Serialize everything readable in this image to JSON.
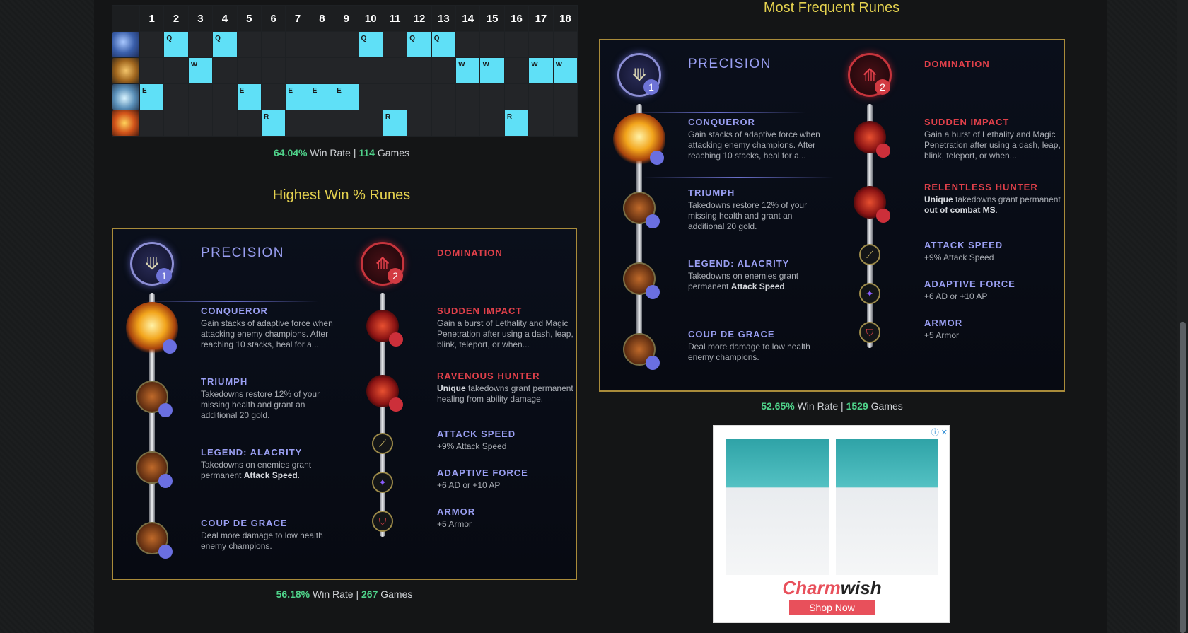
{
  "skill_order": {
    "levels": [
      "1",
      "2",
      "3",
      "4",
      "5",
      "6",
      "7",
      "8",
      "9",
      "10",
      "11",
      "12",
      "13",
      "14",
      "15",
      "16",
      "17",
      "18"
    ],
    "rows": [
      {
        "ability": "q-ability-icon",
        "keys": [
          "",
          "Q",
          "",
          "Q",
          "",
          "",
          "",
          "",
          "",
          "Q",
          "",
          "Q",
          "Q",
          "",
          "",
          "",
          "",
          ""
        ]
      },
      {
        "ability": "w-ability-icon",
        "keys": [
          "",
          "",
          "W",
          "",
          "",
          "",
          "",
          "",
          "",
          "",
          "",
          "",
          "",
          "W",
          "W",
          "",
          "W",
          "W"
        ]
      },
      {
        "ability": "e-ability-icon",
        "keys": [
          "E",
          "",
          "",
          "",
          "E",
          "",
          "E",
          "E",
          "E",
          "",
          "",
          "",
          "",
          "",
          "",
          "",
          "",
          ""
        ]
      },
      {
        "ability": "r-ability-icon",
        "keys": [
          "",
          "",
          "",
          "",
          "",
          "R",
          "",
          "",
          "",
          "",
          "R",
          "",
          "",
          "",
          "",
          "R",
          "",
          ""
        ]
      }
    ],
    "win_rate": "64.04%",
    "win_rate_label": "Win Rate |",
    "games": "114",
    "games_label": "Games"
  },
  "highest_win": {
    "title": "Highest Win % Runes",
    "primary_tree": "PRECISION",
    "primary_num": "1",
    "secondary_tree": "DOMINATION",
    "secondary_num": "2",
    "primary_runes": [
      {
        "name": "CONQUEROR",
        "desc": "Gain stacks of adaptive force when attacking enemy champions. After reaching 10 stacks, heal for a..."
      },
      {
        "name": "TRIUMPH",
        "desc": "Takedowns restore 12% of your missing health and grant an additional 20 gold."
      },
      {
        "name": "LEGEND: ALACRITY",
        "desc_pre": "Takedowns on enemies grant permanent ",
        "desc_bold": "Attack Speed",
        "desc_post": "."
      },
      {
        "name": "COUP DE GRACE",
        "desc": "Deal more damage to low health enemy champions."
      }
    ],
    "secondary_runes": [
      {
        "name": "SUDDEN IMPACT",
        "desc": "Gain a burst of Lethality and Magic Penetration after using a dash, leap, blink, teleport, or when..."
      },
      {
        "name": "RAVENOUS HUNTER",
        "desc_bold": "Unique",
        "desc_post": " takedowns grant permanent healing from ability damage."
      }
    ],
    "shards": [
      {
        "name": "ATTACK SPEED",
        "desc": "+9% Attack Speed"
      },
      {
        "name": "ADAPTIVE FORCE",
        "desc": "+6 AD or +10 AP"
      },
      {
        "name": "ARMOR",
        "desc": "+5 Armor"
      }
    ],
    "win_rate": "56.18%",
    "win_rate_label": "Win Rate |",
    "games": "267",
    "games_label": "Games"
  },
  "most_frequent": {
    "title": "Most Frequent Runes",
    "primary_tree": "PRECISION",
    "primary_num": "1",
    "secondary_tree": "DOMINATION",
    "secondary_num": "2",
    "primary_runes": [
      {
        "name": "CONQUEROR",
        "desc": "Gain stacks of adaptive force when attacking enemy champions. After reaching 10 stacks, heal for a..."
      },
      {
        "name": "TRIUMPH",
        "desc": "Takedowns restore 12% of your missing health and grant an additional 20 gold."
      },
      {
        "name": "LEGEND: ALACRITY",
        "desc_pre": "Takedowns on enemies grant permanent ",
        "desc_bold": "Attack Speed",
        "desc_post": "."
      },
      {
        "name": "COUP DE GRACE",
        "desc": "Deal more damage to low health enemy champions."
      }
    ],
    "secondary_runes": [
      {
        "name": "SUDDEN IMPACT",
        "desc": "Gain a burst of Lethality and Magic Penetration after using a dash, leap, blink, teleport, or when..."
      },
      {
        "name": "RELENTLESS HUNTER",
        "desc_bold": "Unique",
        "desc_post": " takedowns grant permanent ",
        "desc_bold2": "out of combat MS",
        "desc_post2": "."
      }
    ],
    "shards": [
      {
        "name": "ATTACK SPEED",
        "desc": "+9% Attack Speed"
      },
      {
        "name": "ADAPTIVE FORCE",
        "desc": "+6 AD or +10 AP"
      },
      {
        "name": "ARMOR",
        "desc": "+5 Armor"
      }
    ],
    "win_rate": "52.65%",
    "win_rate_label": "Win Rate |",
    "games": "1529",
    "games_label": "Games"
  },
  "ad": {
    "brand_part1": "Charm",
    "brand_part2": "wish",
    "button": "Shop Now",
    "close": "ⓘ ✕"
  },
  "colors": {
    "highlight": "#5fe0f7",
    "gold_title": "#e5d24f",
    "win_green": "#4fd28a",
    "precision": "#9a9ff2",
    "domination": "#e0404a"
  }
}
